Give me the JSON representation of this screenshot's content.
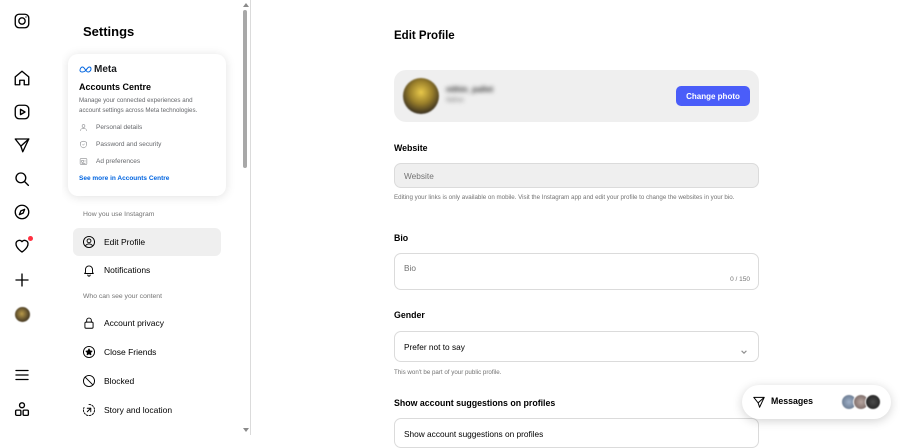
{
  "rail": {
    "items": [
      {
        "icon": "instagram-logo-icon"
      },
      {
        "icon": "home-icon"
      },
      {
        "icon": "reels-icon"
      },
      {
        "icon": "direct-icon"
      },
      {
        "icon": "search-icon"
      },
      {
        "icon": "explore-icon"
      },
      {
        "icon": "heart-icon",
        "badge": true
      },
      {
        "icon": "create-icon"
      },
      {
        "icon": "profile-avatar-icon"
      },
      {
        "icon": "menu-icon"
      },
      {
        "icon": "threads-more-icon"
      }
    ]
  },
  "settings": {
    "title": "Settings",
    "accounts_centre": {
      "brand": "Meta",
      "title": "Accounts Centre",
      "description": "Manage your connected experiences and account settings across Meta technologies.",
      "items": [
        {
          "icon": "person-icon",
          "label": "Personal details"
        },
        {
          "icon": "shield-icon",
          "label": "Password and security"
        },
        {
          "icon": "newspaper-icon",
          "label": "Ad preferences"
        }
      ],
      "link": "See more in Accounts Centre"
    },
    "section1_label": "How you use Instagram",
    "section1_items": [
      {
        "icon": "user-circle-icon",
        "label": "Edit Profile",
        "active": true
      },
      {
        "icon": "bell-icon",
        "label": "Notifications"
      }
    ],
    "section2_label": "Who can see your content",
    "section2_items": [
      {
        "icon": "lock-icon",
        "label": "Account privacy"
      },
      {
        "icon": "star-circle-icon",
        "label": "Close Friends"
      },
      {
        "icon": "blocked-icon",
        "label": "Blocked"
      },
      {
        "icon": "story-location-icon",
        "label": "Story and location"
      }
    ]
  },
  "main": {
    "title": "Edit Profile",
    "profile": {
      "username": "nithin_pallet",
      "subname": "Nithin",
      "change_photo": "Change photo"
    },
    "website": {
      "label": "Website",
      "placeholder": "Website",
      "helper": "Editing your links is only available on mobile. Visit the Instagram app and edit your profile to change the websites in your bio."
    },
    "bio": {
      "label": "Bio",
      "placeholder": "Bio",
      "count": "0 / 150"
    },
    "gender": {
      "label": "Gender",
      "value": "Prefer not to say",
      "helper": "This won't be part of your public profile."
    },
    "suggestions": {
      "label": "Show account suggestions on profiles",
      "value": "Show account suggestions on profiles"
    }
  },
  "messages": {
    "label": "Messages"
  },
  "colors": {
    "accent": "#4a5df9",
    "link": "#0064e0",
    "notification": "#ff3040"
  }
}
